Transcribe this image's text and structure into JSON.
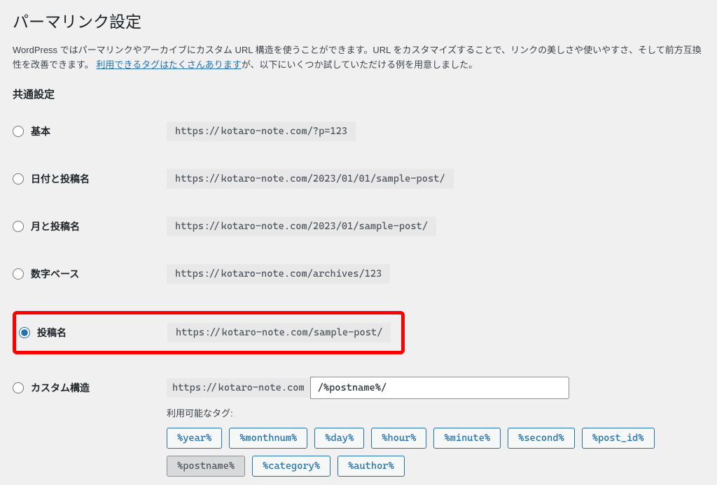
{
  "page": {
    "title": "パーマリンク設定",
    "description_pre": "WordPress ではパーマリンクやアーカイブにカスタム URL 構造を使うことができます。URL をカスタマイズすることで、リンクの美しさや使いやすさ、そして前方互換性を改善できます。",
    "description_link": "利用できるタグはたくさんあります",
    "description_post": "が、以下にいくつか試していただける例を用意しました。"
  },
  "section": {
    "title": "共通設定"
  },
  "options": {
    "default": {
      "label": "基本",
      "url": "https://kotaro-note.com/?p=123"
    },
    "day_name": {
      "label": "日付と投稿名",
      "url": "https://kotaro-note.com/2023/01/01/sample-post/"
    },
    "month_name": {
      "label": "月と投稿名",
      "url": "https://kotaro-note.com/2023/01/sample-post/"
    },
    "numeric": {
      "label": "数字ベース",
      "url": "https://kotaro-note.com/archives/123"
    },
    "post_name": {
      "label": "投稿名",
      "url": "https://kotaro-note.com/sample-post/"
    },
    "custom": {
      "label": "カスタム構造",
      "base": "https://kotaro-note.com",
      "value": "/%postname%/",
      "tags_label": "利用可能なタグ:",
      "tags": [
        "%year%",
        "%monthnum%",
        "%day%",
        "%hour%",
        "%minute%",
        "%second%",
        "%post_id%",
        "%postname%",
        "%category%",
        "%author%"
      ]
    }
  }
}
